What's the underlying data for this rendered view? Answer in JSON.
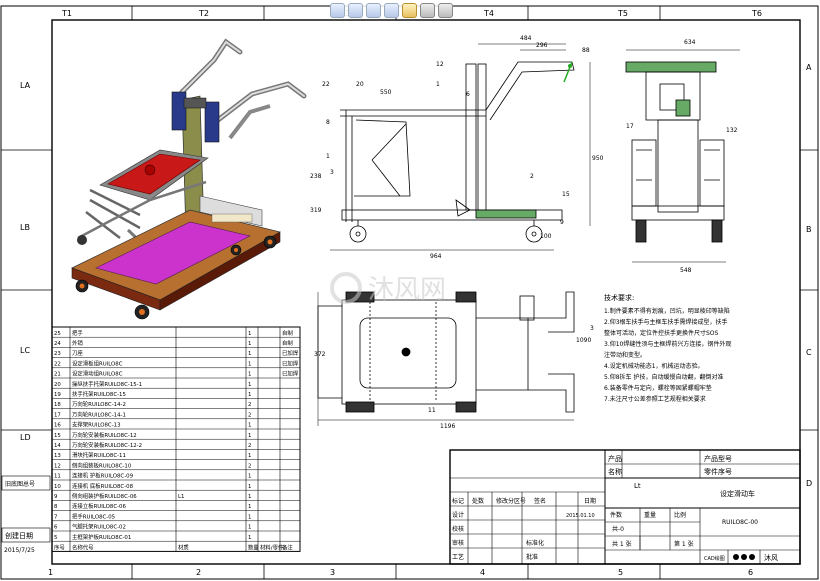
{
  "viewer_toolbar": {
    "icons": [
      "zoom-fit-icon",
      "zoom-area-icon",
      "section-view-icon",
      "rotate-icon",
      "display-style-icon",
      "appearance-icon",
      "view-settings-icon"
    ]
  },
  "frame": {
    "top_zones": [
      "T1",
      "T2",
      "T3",
      "T4",
      "T5",
      "T6"
    ],
    "bottom_zones": [
      "1",
      "2",
      "3",
      "4",
      "5",
      "6"
    ],
    "left_zones": [
      "LA",
      "LB",
      "LC",
      "LD"
    ],
    "right_zones": [
      "A",
      "B",
      "C",
      "D"
    ]
  },
  "left_strip": {
    "label_1": "旧底图总号",
    "label_2": "创建日期",
    "date": "2015/7/25"
  },
  "watermark": "沐风网",
  "dimensions": {
    "side": [
      "484",
      "296",
      "88",
      "12",
      "22",
      "550",
      "20",
      "8",
      "1",
      "3",
      "238",
      "319",
      "950",
      "2",
      "15",
      "9",
      "964",
      "100",
      "1",
      "6"
    ],
    "end": [
      "634",
      "17",
      "132",
      "548"
    ],
    "top_view": [
      "1196",
      "372",
      "1090",
      "3",
      "11"
    ]
  },
  "tech_requirements": {
    "title": "技术要求:",
    "items": [
      "1.制件要素不得有划痕，凹坑，明显棱印等缺陷",
      "2.仰3根车扶手与主框车扶手需焊接成型，扶手",
      "整体可活动，定位件控扶手更换件尺寸SOS",
      "3.仰10焊缝性须与主框焊前兴方连接，钢件外观",
      "注带动和变型。",
      "4.设定机械功能态1，机械运动态验。",
      "5.仰8拆车 护技，自动缓慢自动翻，翻倒对准",
      "6.装备零件与定向，螺栓等固紧螺帽牢垫",
      "7.未注尺寸公差参照工艺规程相关要求"
    ]
  },
  "bom": {
    "headers": [
      "序号",
      "名称代号",
      "材质",
      "数量",
      "材料/零件",
      "备注"
    ],
    "rows": [
      [
        "25",
        "把手",
        "",
        "1",
        "",
        "自制"
      ],
      [
        "24",
        "外销",
        "",
        "1",
        "",
        "自制"
      ],
      [
        "23",
        "刀座",
        "",
        "1",
        "",
        "已加焊"
      ],
      [
        "22",
        "设定滑板组RUILO8C",
        "",
        "1",
        "",
        "已加焊"
      ],
      [
        "21",
        "设定滑动组RUILO8C",
        "",
        "1",
        "",
        "已加焊"
      ],
      [
        "20",
        "操纵扶手托架RUILO8C-15-1",
        "",
        "1",
        "",
        ""
      ],
      [
        "19",
        "扶手托架RUILO8C-15",
        "",
        "1",
        "",
        ""
      ],
      [
        "18",
        "万向轮RUILO8C-14-2",
        "",
        "2",
        "",
        ""
      ],
      [
        "17",
        "万向轮RUILO8C-14-1",
        "",
        "2",
        "",
        ""
      ],
      [
        "16",
        "支撑架RUILO8C-13",
        "",
        "1",
        "",
        ""
      ],
      [
        "15",
        "万向轮安装板RUILO8C-12",
        "",
        "1",
        "",
        ""
      ],
      [
        "14",
        "万向轮安装板RUILO8C-12-2",
        "",
        "2",
        "",
        ""
      ],
      [
        "13",
        "滑块托架RUILO8C-11",
        "",
        "1",
        "",
        ""
      ],
      [
        "12",
        "侧向组装板RUILO8C-10",
        "",
        "2",
        "",
        ""
      ],
      [
        "11",
        "连接机 护板RUILO8C-09",
        "",
        "1",
        "",
        ""
      ],
      [
        "10",
        "连接机 底板RUILO8C-08",
        "",
        "1",
        "",
        ""
      ],
      [
        "9",
        "侧向组装护板RUILO8C-06",
        "L1",
        "1",
        "",
        ""
      ],
      [
        "8",
        "连接立板RUILO8C-06",
        "",
        "1",
        "",
        ""
      ],
      [
        "7",
        "把手RUILO8C-05",
        "",
        "1",
        "",
        ""
      ],
      [
        "6",
        "气腿托架RUILO8C-02",
        "",
        "1",
        "",
        ""
      ],
      [
        "5",
        "主框架护板RUILO8C-01",
        "",
        "1",
        "",
        ""
      ]
    ]
  },
  "title_block": {
    "product_model_label": "产品型号",
    "part_no_label": "零件序号",
    "product_label": "产品",
    "name_label": "名称",
    "material_mark": "Lt",
    "title": "设定滑动车",
    "rev_header": [
      "标记",
      "处数",
      "修改分区号",
      "签名",
      "日期"
    ],
    "sign_rows": [
      [
        "设计",
        "",
        "8",
        "阶",
        "2015.01.10"
      ],
      [
        "校核",
        "",
        "",
        "",
        ""
      ],
      [
        "审核",
        "",
        "标准化",
        "",
        ""
      ],
      [
        "工艺",
        "",
        "批准",
        "",
        ""
      ]
    ],
    "sign_labels": [
      "设计",
      "校核",
      "审核",
      "工艺"
    ],
    "std_label": "标准化",
    "approve_label": "批准",
    "designer_date": "2015.01.10",
    "stage_header": [
      "件数",
      "重量",
      "比例"
    ],
    "stage_value": "共-0",
    "sheets": "共 1 张",
    "sheet_no": "第 1 张",
    "drawing_no": "RUILO8C-00",
    "cad_label": "CAD绘图",
    "logo_label": "沐风"
  }
}
